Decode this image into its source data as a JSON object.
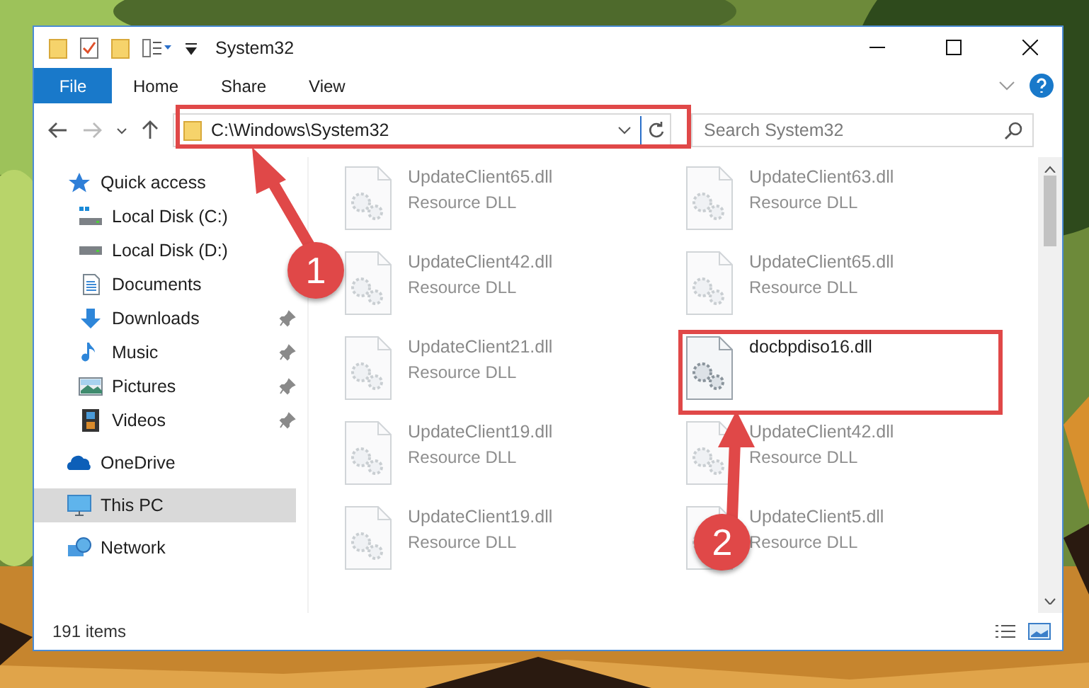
{
  "window": {
    "title": "System32"
  },
  "ribbon_tabs": [
    {
      "label": "File",
      "kind": "file"
    },
    {
      "label": "Home",
      "kind": "tab"
    },
    {
      "label": "Share",
      "kind": "tab"
    },
    {
      "label": "View",
      "kind": "tab"
    }
  ],
  "address": {
    "path": "C:\\Windows\\System32"
  },
  "search": {
    "placeholder": "Search System32"
  },
  "nav": [
    {
      "label": "Quick access",
      "kind": "star",
      "selected": false,
      "children": [
        {
          "label": "Local Disk (C:)",
          "kind": "system-drive",
          "pinned": false
        },
        {
          "label": "Local Disk (D:)",
          "kind": "drive",
          "pinned": false
        },
        {
          "label": "Documents",
          "kind": "documents",
          "pinned": false
        },
        {
          "label": "Downloads",
          "kind": "downloads",
          "pinned": true
        },
        {
          "label": "Music",
          "kind": "music",
          "pinned": true
        },
        {
          "label": "Pictures",
          "kind": "pictures",
          "pinned": true
        },
        {
          "label": "Videos",
          "kind": "videos",
          "pinned": true
        }
      ]
    },
    {
      "label": "OneDrive",
      "kind": "cloud",
      "selected": false
    },
    {
      "label": "This PC",
      "kind": "computer",
      "selected": true
    },
    {
      "label": "Network",
      "kind": "network",
      "selected": false
    }
  ],
  "files": [
    {
      "name": "UpdateClient65.dll",
      "type": "Resource DLL",
      "dimmed": true
    },
    {
      "name": "UpdateClient63.dll",
      "type": "Resource DLL",
      "dimmed": true
    },
    {
      "name": "UpdateClient42.dll",
      "type": "Resource DLL",
      "dimmed": true
    },
    {
      "name": "UpdateClient65.dll",
      "type": "Resource DLL",
      "dimmed": true
    },
    {
      "name": "UpdateClient21.dll",
      "type": "Resource DLL",
      "dimmed": true
    },
    {
      "name": "docbpdiso16.dll",
      "dimmed": false
    },
    {
      "name": "UpdateClient19.dll",
      "type": "Resource DLL",
      "dimmed": true
    },
    {
      "name": "UpdateClient42.dll",
      "type": "Resource DLL",
      "dimmed": true
    },
    {
      "name": "UpdateClient19.dll",
      "type": "Resource DLL",
      "dimmed": true
    },
    {
      "name": "UpdateClient5.dll",
      "type": "Resource DLL",
      "dimmed": true
    }
  ],
  "status_bar": {
    "item_count": "191 items"
  },
  "annotations": [
    {
      "number": "1"
    },
    {
      "number": "2"
    }
  ]
}
